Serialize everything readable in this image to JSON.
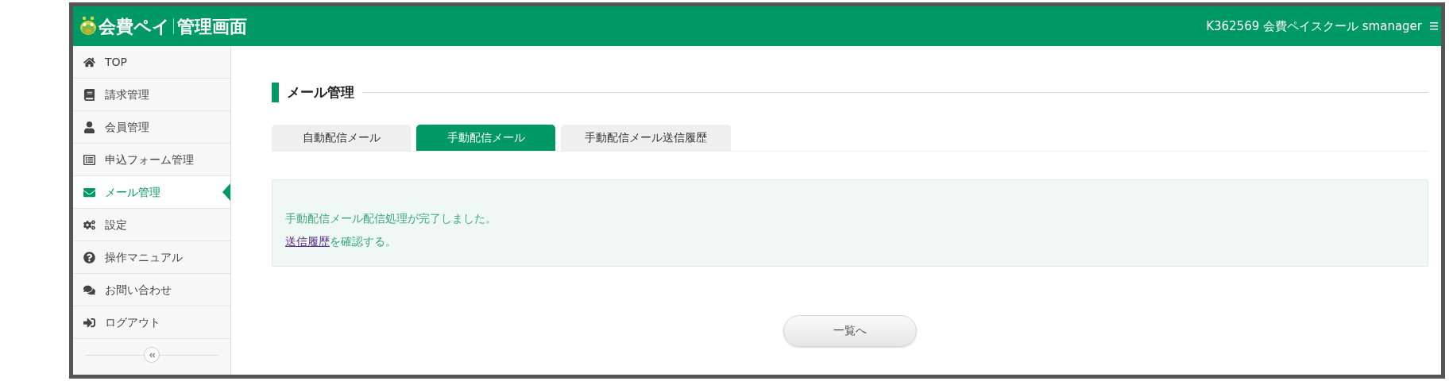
{
  "header": {
    "logo_text": "会費ペイ",
    "subtitle": "管理画面",
    "user": "K362569 会費ペイスクール smanager"
  },
  "sidebar": {
    "items": [
      {
        "label": "TOP",
        "selected": false
      },
      {
        "label": "請求管理",
        "selected": false
      },
      {
        "label": "会員管理",
        "selected": false
      },
      {
        "label": "申込フォーム管理",
        "selected": false
      },
      {
        "label": "メール管理",
        "selected": true
      },
      {
        "label": "設定",
        "selected": false
      },
      {
        "label": "操作マニュアル",
        "selected": false
      },
      {
        "label": "お問い合わせ",
        "selected": false
      },
      {
        "label": "ログアウト",
        "selected": false
      }
    ]
  },
  "page": {
    "title": "メール管理",
    "tabs": [
      {
        "label": "自動配信メール",
        "selected": false
      },
      {
        "label": "手動配信メール",
        "selected": true
      },
      {
        "label": "手動配信メール送信履歴",
        "selected": false
      }
    ],
    "message": {
      "text": "手動配信メール配信処理が完了しました。",
      "link": "送信履歴",
      "link_suffix": "を確認する。"
    },
    "back_button": "一覧へ"
  }
}
